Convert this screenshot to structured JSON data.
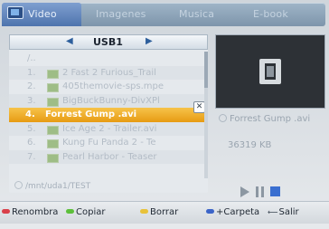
{
  "menu": {
    "tabs": [
      {
        "label": "Video",
        "active": true
      },
      {
        "label": "Imagenes",
        "active": false
      },
      {
        "label": "Musica",
        "active": false
      },
      {
        "label": "E-book",
        "active": false
      }
    ]
  },
  "device": {
    "name": "USB1",
    "left_arrow": "◀",
    "right_arrow": "▶"
  },
  "files": [
    {
      "num": "/..",
      "name": ""
    },
    {
      "num": "1.",
      "name": "2 Fast 2 Furious_Trail"
    },
    {
      "num": "2.",
      "name": "405themovie-sps.mpe"
    },
    {
      "num": "3.",
      "name": "BigBuckBunny-DivXPl"
    },
    {
      "num": "4.",
      "name": "Forrest Gump .avi",
      "selected": true
    },
    {
      "num": "5.",
      "name": "Ice Age 2 - Trailer.avi"
    },
    {
      "num": "6.",
      "name": "Kung Fu Panda 2 - Te"
    },
    {
      "num": "7.",
      "name": "Pearl Harbor - Teaser"
    }
  ],
  "close_mark": "✕",
  "path": "/mnt/uda1/TEST",
  "info": {
    "filename": "Forrest Gump .avi",
    "size": "36319 KB"
  },
  "help": {
    "renombra": "Renombra",
    "copiar": "Copiar",
    "borrar": "Borrar",
    "carpeta": "+Carpeta",
    "salir": "Salir",
    "salir_key": "⟵"
  },
  "colors": {
    "red": "#d9404a",
    "green": "#5cbf3a",
    "yellow": "#e8c23a",
    "blue": "#3b64c8",
    "selection": "#f0ac24"
  }
}
